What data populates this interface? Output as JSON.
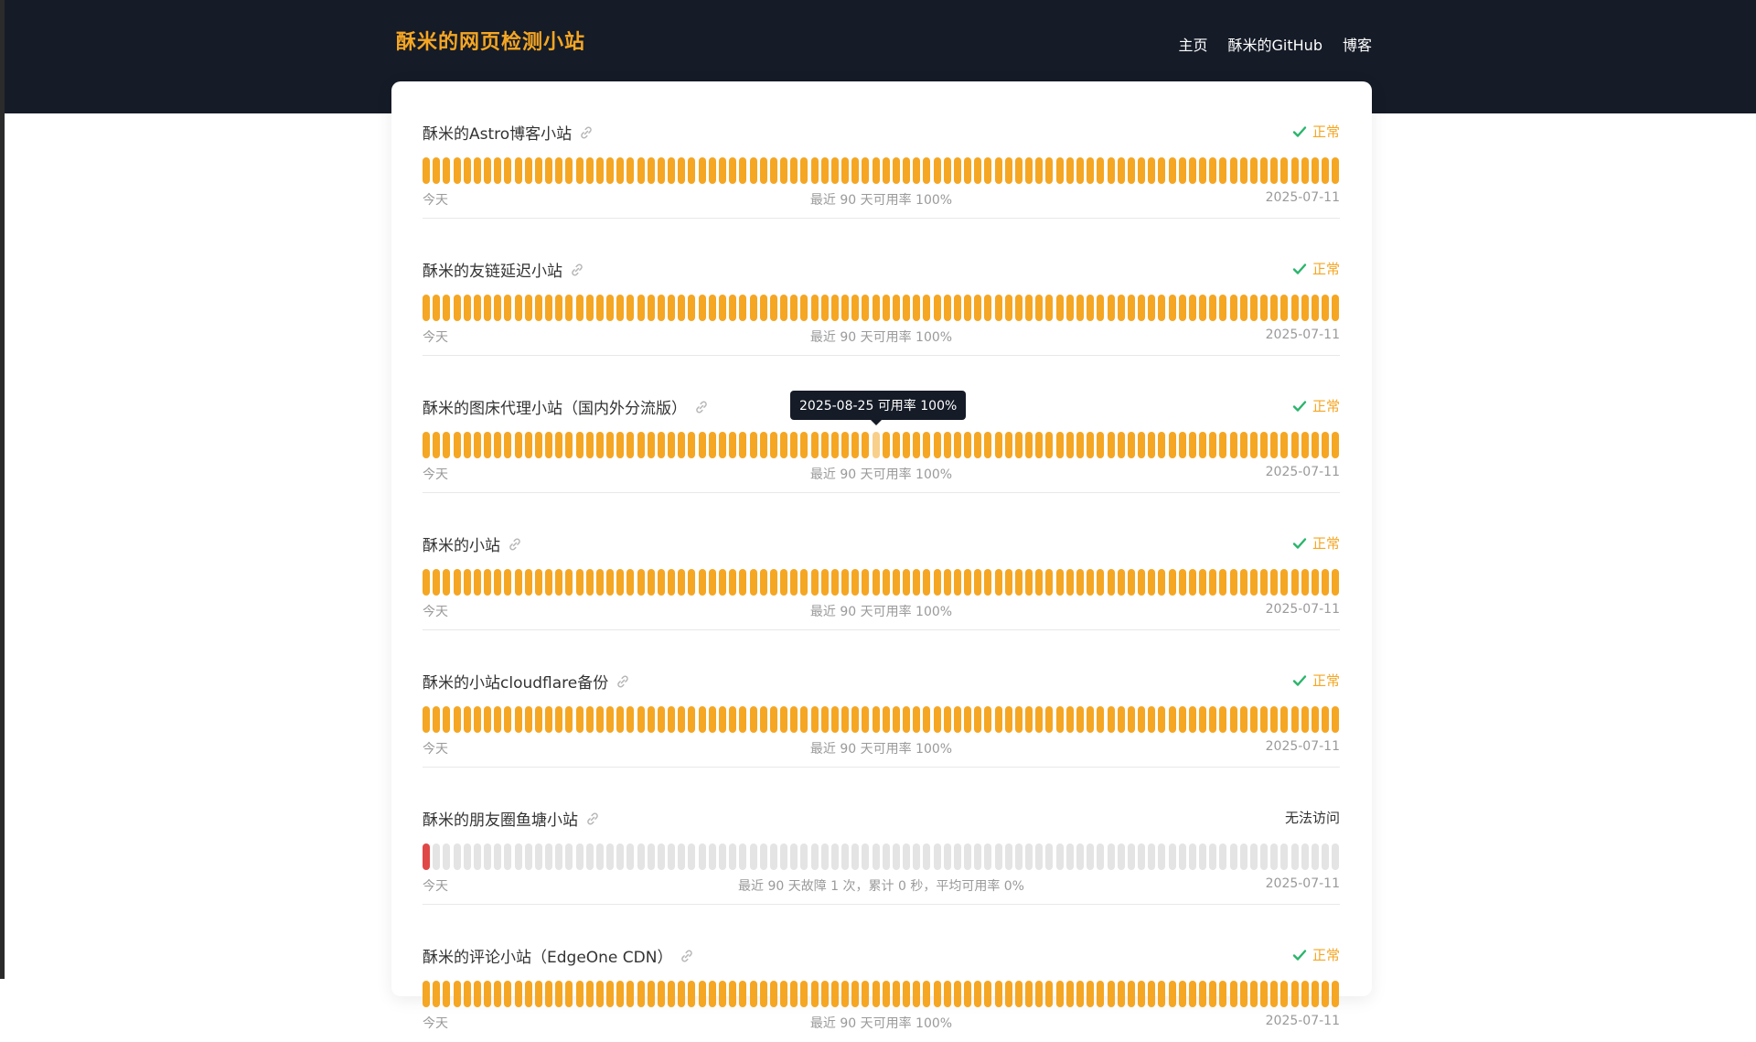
{
  "header": {
    "brand": "酥米的网页检测小站",
    "nav": [
      "主页",
      "酥米的GitHub",
      "博客"
    ]
  },
  "colors": {
    "header_bg": "#151b27",
    "accent": "#f5a623",
    "bar_up": "#f5a623",
    "bar_empty": "#e4e4e4",
    "bar_fail": "#e04848",
    "status_ok_check": "#2ab56c"
  },
  "tooltip": {
    "text": "2025-08-25 可用率 100%",
    "monitor_index": 2,
    "bar_index": 44
  },
  "monitors": [
    {
      "name": "酥米的Astro博客小站",
      "status": "正常",
      "status_icon": "check-icon",
      "state": "up",
      "day_count": 90,
      "failed_days": [],
      "foot_left": "今天",
      "foot_mid": "最近 90 天可用率 100%",
      "foot_right": "2025-07-11"
    },
    {
      "name": "酥米的友链延迟小站",
      "status": "正常",
      "status_icon": "check-icon",
      "state": "up",
      "day_count": 90,
      "failed_days": [],
      "foot_left": "今天",
      "foot_mid": "最近 90 天可用率 100%",
      "foot_right": "2025-07-11"
    },
    {
      "name": "酥米的图床代理小站（国内外分流版）",
      "status": "正常",
      "status_icon": "check-icon",
      "state": "up",
      "day_count": 90,
      "failed_days": [],
      "foot_left": "今天",
      "foot_mid": "最近 90 天可用率 100%",
      "foot_right": "2025-07-11"
    },
    {
      "name": "酥米的小站",
      "status": "正常",
      "status_icon": "check-icon",
      "state": "up",
      "day_count": 90,
      "failed_days": [],
      "foot_left": "今天",
      "foot_mid": "最近 90 天可用率 100%",
      "foot_right": "2025-07-11"
    },
    {
      "name": "酥米的小站cloudflare备份",
      "status": "正常",
      "status_icon": "check-icon",
      "state": "up",
      "day_count": 90,
      "failed_days": [],
      "foot_left": "今天",
      "foot_mid": "最近 90 天可用率 100%",
      "foot_right": "2025-07-11"
    },
    {
      "name": "酥米的朋友圈鱼塘小站",
      "status": "无法访问",
      "status_icon": "",
      "state": "down",
      "day_count": 90,
      "failed_days": [
        0
      ],
      "foot_left": "今天",
      "foot_mid": "最近 90 天故障 1 次，累计 0 秒，平均可用率 0%",
      "foot_right": "2025-07-11"
    },
    {
      "name": "酥米的评论小站（EdgeOne CDN）",
      "status": "正常",
      "status_icon": "check-icon",
      "state": "up",
      "day_count": 90,
      "failed_days": [],
      "foot_left": "今天",
      "foot_mid": "最近 90 天可用率 100%",
      "foot_right": "2025-07-11"
    }
  ]
}
